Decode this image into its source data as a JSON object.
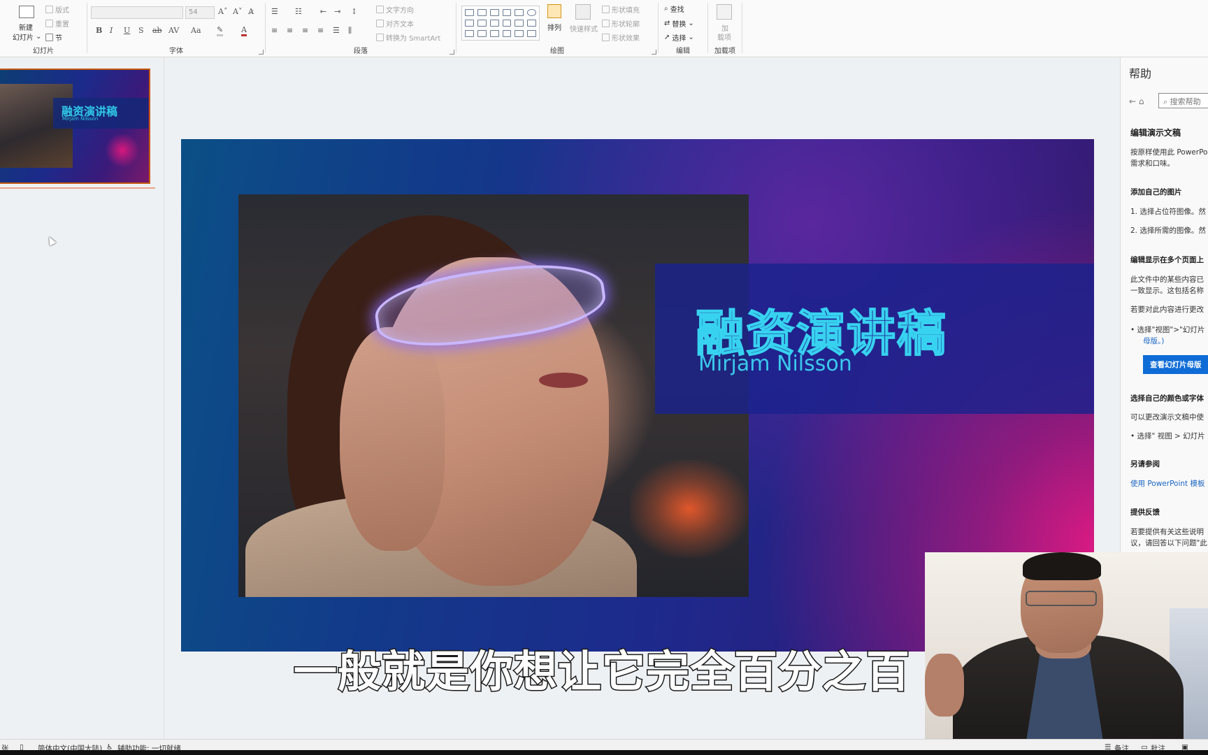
{
  "ribbon": {
    "slides_group": {
      "new_slide": "新建",
      "new_slide_2": "幻灯片",
      "layout": "版式",
      "reset": "重置",
      "section": "节",
      "label": "幻灯片"
    },
    "font_group": {
      "font_size": "54",
      "label": "字体",
      "bold": "B",
      "italic": "I",
      "underline": "U",
      "strike": "S",
      "shadow": "ab",
      "spacing": "AV",
      "case": "Aa"
    },
    "paragraph_group": {
      "text_direction": "文字方向",
      "align_text": "对齐文本",
      "smartart": "转换为 SmartArt",
      "label": "段落"
    },
    "drawing_group": {
      "arrange": "排列",
      "quick_styles": "快速样式",
      "fill": "形状填充",
      "outline": "形状轮廓",
      "effects": "形状效果",
      "label": "绘图"
    },
    "editing_group": {
      "find": "查找",
      "replace": "替换",
      "select": "选择",
      "label": "编辑"
    },
    "addins_group": {
      "addins": "加",
      "addins_2": "载项",
      "label": "加载项"
    }
  },
  "thumbnail": {
    "title": "融资演讲稿",
    "subtitle": "Mirjam Nilsson"
  },
  "slide": {
    "title": "融资演讲稿",
    "subtitle": "Mirjam Nilsson"
  },
  "help": {
    "title": "帮助",
    "search_placeholder": "搜索帮助",
    "heading": "编辑演示文稿",
    "intro_1": "按原样使用此 PowerPo",
    "intro_2": "需求和口味。",
    "section_pictures": "添加自己的图片",
    "step_1": "1.  选择占位符图像。然",
    "step_2": "2.  选择所需的图像。然",
    "section_repeat": "编辑显示在多个页面上",
    "repeat_1": "此文件中的某些内容已",
    "repeat_2": "一致显示。这包括名称",
    "repeat_3": "若要对此内容进行更改",
    "bullet_view": "•  选择\"视图\">\"幻灯片",
    "bullet_view_2": "母版。)",
    "master_button": "查看幻灯片母版",
    "section_colors": "选择自己的颜色或字体",
    "colors_1": "可以更改演示文稿中使",
    "bullet_colors": "•  选择\" 视图 > 幻灯片",
    "section_see_also": "另请参阅",
    "link_templates": "使用 PowerPoint 模板",
    "section_feedback": "提供反馈",
    "feedback_1": "若要提供有关这些说明",
    "feedback_2": "议，请回答以下问题\"此"
  },
  "subtitle_overlay": "一般就是你想让它完全百分之百",
  "status_bar": {
    "slide_count": "张",
    "language": "简体中文(中国大陆)",
    "accessibility": "辅助功能: 一切就绪",
    "notes": "备注",
    "comments": "批注"
  },
  "colors": {
    "accent_cyan": "#37d2f0",
    "slide_band": "#1a228c",
    "help_button": "#0f6cd6",
    "thumb_selected": "#c55a11"
  }
}
